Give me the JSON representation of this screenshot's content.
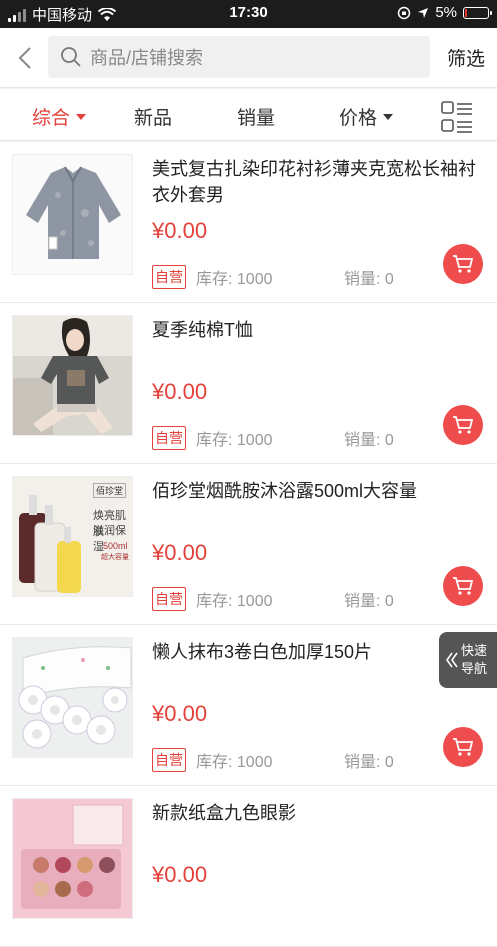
{
  "status_bar": {
    "carrier": "中国移动",
    "time": "17:30",
    "battery": "5%"
  },
  "header": {
    "search_placeholder": "商品/店铺搜索",
    "filter_label": "筛选"
  },
  "tabs": [
    {
      "label": "综合",
      "active": true,
      "has_caret": true
    },
    {
      "label": "新品",
      "active": false,
      "has_caret": false
    },
    {
      "label": "销量",
      "active": false,
      "has_caret": false
    },
    {
      "label": "价格",
      "active": false,
      "has_caret": true
    }
  ],
  "products": [
    {
      "title": "美式复古扎染印花衬衫薄夹克宽松长袖衬衣外套男",
      "price": "¥0.00",
      "badge": "自营",
      "stock": "库存: 1000",
      "sales": "销量: 0",
      "image": "shirt"
    },
    {
      "title": "夏季纯棉T恤",
      "price": "¥0.00",
      "badge": "自营",
      "stock": "库存: 1000",
      "sales": "销量: 0",
      "image": "tshirt-model"
    },
    {
      "title": "佰珍堂烟酰胺沐浴露500ml大容量",
      "price": "¥0.00",
      "badge": "自营",
      "stock": "库存: 1000",
      "sales": "销量: 0",
      "image": "body-wash",
      "image_text": {
        "brand": "佰珍堂",
        "line1": "焕亮肌肤",
        "line2": "滋润保湿",
        "size": "500ml",
        "sub": "超大容量"
      }
    },
    {
      "title": "懒人抹布3卷白色加厚150片",
      "price": "¥0.00",
      "badge": "自营",
      "stock": "库存: 1000",
      "sales": "销量: 0",
      "image": "cloth-rolls"
    },
    {
      "title": "新款纸盒九色眼影",
      "price": "¥0.00",
      "badge": "",
      "stock": "",
      "sales": "",
      "image": "eyeshadow"
    }
  ],
  "quick_nav": {
    "line1": "快速",
    "line2": "导航"
  },
  "colors": {
    "accent": "#e3413a",
    "cart": "#ef4d4d"
  }
}
